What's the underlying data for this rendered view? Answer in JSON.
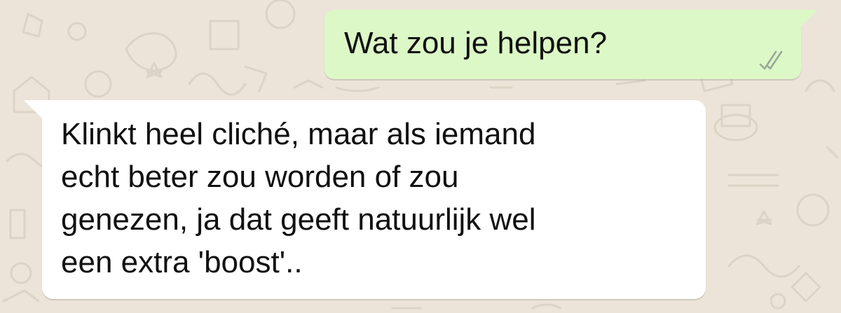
{
  "chat": {
    "outgoing_message": {
      "text": "Wat zou je helpen?",
      "status_icon": "double-check-icon"
    },
    "incoming_message": {
      "lines": [
        "Klinkt heel cliché, maar als iemand",
        "echt beter zou worden of zou",
        "genezen, ja dat geeft natuurlijk wel",
        "een extra 'boost'.."
      ]
    }
  },
  "colors": {
    "background": "#ece4d9",
    "outgoing_bubble": "#dcf8c6",
    "incoming_bubble": "#ffffff",
    "text": "#111111",
    "ticks": "#9aa89a"
  }
}
